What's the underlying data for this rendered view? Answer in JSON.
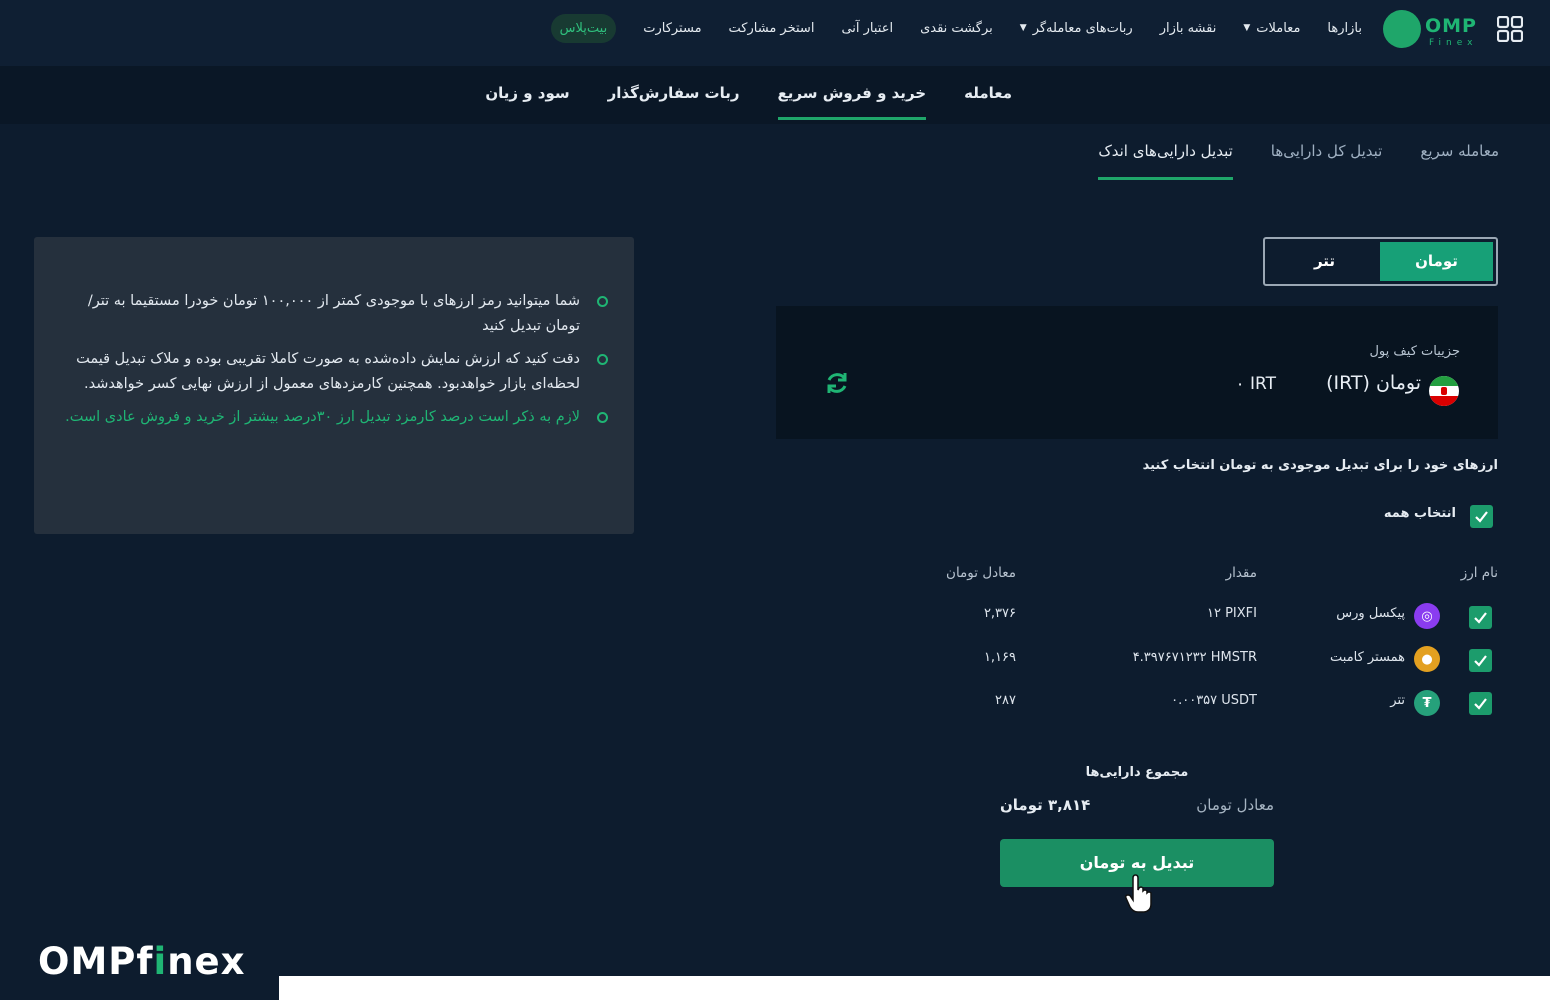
{
  "nav": {
    "brand": "OMP",
    "brand_sub": "Finex",
    "items": [
      {
        "label": "بازارها",
        "caret": false
      },
      {
        "label": "معاملات",
        "caret": true
      },
      {
        "label": "نقشه بازار",
        "caret": false
      },
      {
        "label": "ربات‌های معامله‌گر",
        "caret": true
      },
      {
        "label": "برگشت نقدی",
        "caret": false
      },
      {
        "label": "اعتبار آنی",
        "caret": false
      },
      {
        "label": "استخر مشارکت",
        "caret": false
      },
      {
        "label": "مسترکارت",
        "caret": false
      }
    ],
    "pill": "بیت‌پلاس"
  },
  "subnav": {
    "tabs": [
      "معامله",
      "خرید و فروش سریع",
      "ربات سفارش‌گذار",
      "سود و زیان"
    ],
    "active_index": 1
  },
  "page_tabs": {
    "tabs": [
      "معامله سریع",
      "تبدیل کل دارایی‌ها",
      "تبدیل دارایی‌های اندک"
    ],
    "active_index": 2
  },
  "info": {
    "items": [
      "شما میتوانید رمز ارزهای با موجودی کمتر از ۱۰۰,۰۰۰ تومان خودرا مستقیما به تتر/تومان تبدیل کنید",
      "دقت کنید که ارزش نمایش داده‌شده به صورت کاملا تقریبی بوده و ملاک تبدیل قیمت لحظه‌ای بازار خواهدبود. همچنین کارمزدهای معمول از ارزش نهایی کسر خواهدشد.",
      "لازم به ذکر است درصد کارمزد تبدیل ارز ۳۰درصد بیشتر از خرید و فروش عادی است."
    ]
  },
  "toggle": {
    "on": "تومان",
    "off": "تتر"
  },
  "wallet": {
    "title": "جزییات کیف پول",
    "currency": "تومان (IRT)",
    "balance": "۰ IRT"
  },
  "prompt": "ارزهای خود را برای تبدیل موجودی به تومان انتخاب کنید",
  "select_all": "انتخاب همه",
  "table": {
    "headers": {
      "name": "نام ارز",
      "amount": "مقدار",
      "toman": "معادل تومان"
    },
    "rows": [
      {
        "name": "پیکسل ورس",
        "amount": "۱۲ PIXFI",
        "toman": "۲,۳۷۶",
        "icon": "pixelverse-icon",
        "color": "#8a3cf0"
      },
      {
        "name": "همستر کامبت",
        "amount": "۴.۳۹۷۶۷۱۲۳۲ HMSTR",
        "toman": "۱,۱۶۹",
        "icon": "hamster-icon",
        "color": "#e3a020"
      },
      {
        "name": "تتر",
        "amount": "۰.۰۰۳۵۷ USDT",
        "toman": "۲۸۷",
        "icon": "tether-icon",
        "color": "#26a17b"
      }
    ]
  },
  "summary": {
    "title": "مجموع دارایی‌ها",
    "label": "معادل تومان",
    "value": "۳,۸۱۴ تومان"
  },
  "convert_button": "تبدیل به تومان",
  "footer_logo": {
    "a": "OMPf",
    "i": "i",
    "b": "nex"
  },
  "colors": {
    "accent": "#1fb574",
    "button": "#1b8f63",
    "bg": "#0d1c2e"
  }
}
